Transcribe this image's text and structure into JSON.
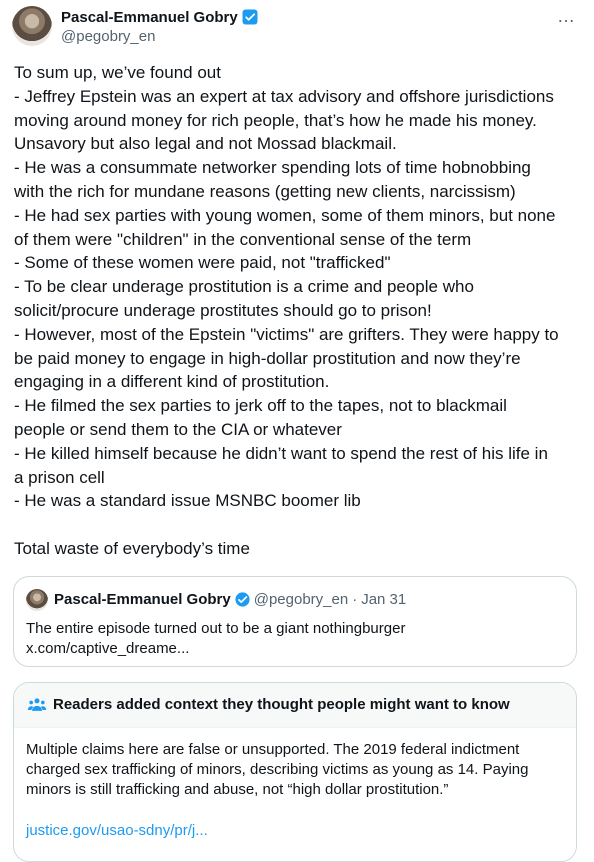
{
  "author": {
    "display_name": "Pascal-Emmanuel Gobry",
    "handle": "@pegobry_en"
  },
  "more_icon": "…",
  "tweet_text": "To sum up, we’ve found out\n- Jeffrey Epstein was an expert at tax advisory and offshore jurisdictions\nmoving around money for rich people, that’s how he made his money.\nUnsavory but also legal and not Mossad blackmail.\n- He was a consummate networker spending lots of time hobnobbing\nwith the rich for mundane reasons (getting new clients, narcissism)\n- He had sex parties with young women, some of them minors, but none\nof them were \"children\" in the conventional sense of the term\n- Some of these women were paid, not \"trafficked\"\n- To be clear underage prostitution is a crime and people who\nsolicit/procure underage prostitutes should go to prison!\n- However, most of the Epstein \"victims\" are grifters. They were happy to\nbe paid money to engage in high-dollar prostitution and now they’re\nengaging in a different kind of prostitution.\n- He filmed the sex parties to jerk off to the tapes, not to blackmail\npeople or send them to the CIA or whatever\n- He killed himself because he didn’t want to spend the rest of his life in\na prison cell\n- He was a standard issue MSNBC boomer lib\n\nTotal waste of everybody’s time",
  "quote": {
    "display_name": "Pascal-Emmanuel Gobry",
    "handle": "@pegobry_en",
    "separator": "·",
    "date": "Jan 31",
    "text": "The entire episode turned out to be a giant nothingburger\nx.com/captive_dreame..."
  },
  "community_note": {
    "title": "Readers added context they thought people might want to know",
    "body": "Multiple claims here are false or unsupported. The 2019 federal indictment charged sex trafficking of minors, describing victims as young as 14. Paying minors is still trafficking and abuse, not “high dollar prostitution.”",
    "link": "justice.gov/usao-sdny/pr/j..."
  },
  "colors": {
    "verified_blue": "#1d9bf0",
    "secondary_text": "#536471",
    "link": "#1d9bf0",
    "border": "#cfd9de"
  }
}
